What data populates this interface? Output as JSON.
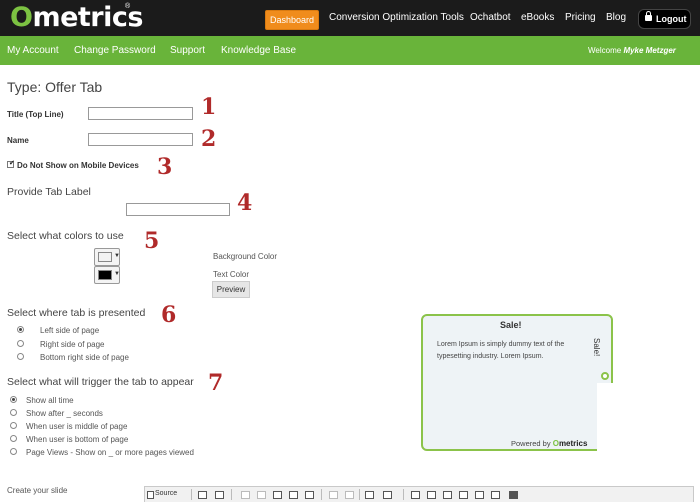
{
  "app": {
    "logo_first": "O",
    "logo_rest": "metrics",
    "logo_reg": "®"
  },
  "topnav": {
    "dashboard": "Dashboard",
    "items": [
      "Conversion Optimization Tools",
      "Ochatbot",
      "eBooks",
      "Pricing",
      "Blog"
    ],
    "logout": "Logout"
  },
  "subnav": {
    "items": [
      "My Account",
      "Change Password",
      "Support",
      "Knowledge Base"
    ],
    "welcome_prefix": "Welcome",
    "user": "Myke Metzger"
  },
  "form": {
    "title": "Type: Offer Tab",
    "title_label": "Title (Top Line)",
    "title_value": "",
    "name_label": "Name",
    "name_value": "",
    "mobile_label": "Do Not Show on Mobile Devices",
    "mobile_checked": true,
    "tab_label_heading": "Provide Tab Label",
    "tab_label_value": "",
    "colors_heading": "Select what colors to use",
    "background_color": "#f2f2f2",
    "text_color": "#000000",
    "background_label": "Background Color",
    "text_label": "Text Color",
    "preview_button": "Preview",
    "position_heading": "Select where tab is presented",
    "positions": [
      "Left side of page",
      "Right side of page",
      "Bottom right side of page"
    ],
    "position_selected": 0,
    "trigger_heading": "Select what will trigger the tab to appear",
    "triggers": [
      "Show all time",
      "Show after _ seconds",
      "When user is middle of page",
      "When user is bottom of page",
      "Page Views - Show on _ or more pages viewed"
    ],
    "trigger_selected": 0,
    "create_slide_label": "Create your slide"
  },
  "annotations": [
    "1",
    "2",
    "3",
    "4",
    "5",
    "6",
    "7"
  ],
  "preview_tab": {
    "title": "Sale!",
    "body": "Lorem Ipsum is simply dummy text of the typesetting industry. Lorem Ipsum.",
    "tab_label": "Sale!",
    "powered_by": "Powered by",
    "brand_first": "O",
    "brand_rest": "metrics"
  },
  "editor_toolbar": {
    "source": "Source"
  },
  "colors": {
    "brand_green": "#69b43a",
    "accent_orange": "#f08c1c",
    "annotation_red": "#b02a2a",
    "topbar": "#1b1b1b"
  }
}
